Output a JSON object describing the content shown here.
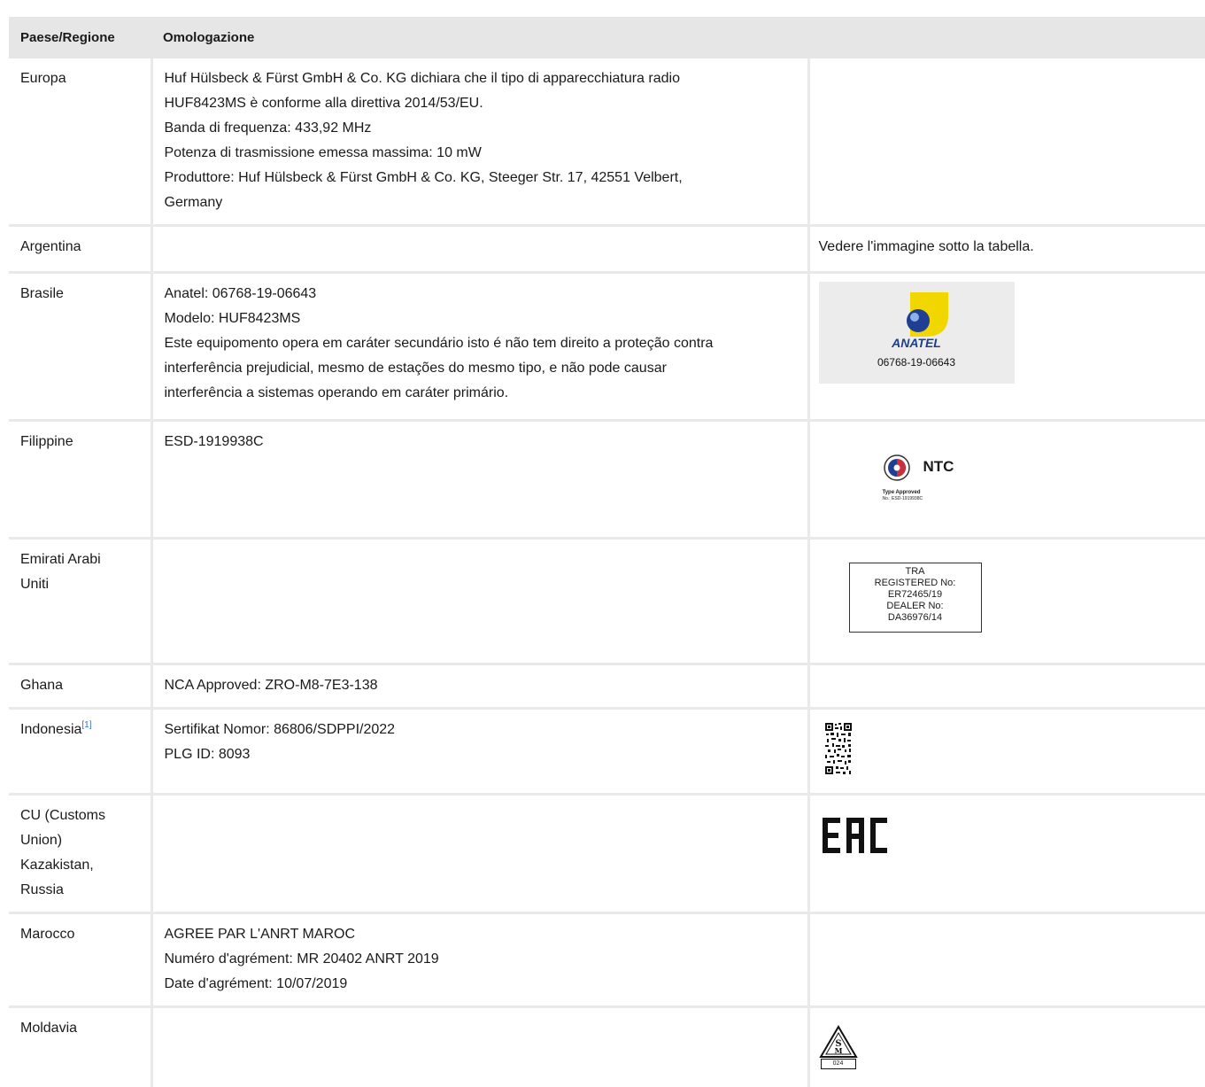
{
  "header": {
    "col1": "Paese/Regione",
    "col2": "Omologazione"
  },
  "rows": [
    {
      "region": "Europa",
      "lines": [
        "Huf Hülsbeck & Fürst GmbH & Co. KG dichiara che il tipo di apparecchiatura radio",
        "HUF8423MS è conforme alla direttiva 2014/53/EU.",
        "Banda di frequenza: 433,92 MHz",
        "Potenza di trasmissione emessa massima: 10 mW",
        "Produttore: Huf Hülsbeck & Fürst GmbH & Co. KG, Steeger Str. 17, 42551 Velbert,",
        "Germany"
      ]
    },
    {
      "region": "Argentina",
      "note": "Vedere l'immagine sotto la tabella."
    },
    {
      "region": "Brasile",
      "lines": [
        "Anatel: 06768-19-06643",
        "Modelo: HUF8423MS",
        "Este equipomento opera em caráter secundário isto é não tem direito a proteção contra",
        "interferência prejudicial, mesmo de estações do mesmo tipo, e não pode causar",
        "interferência a sistemas operando em caráter primário."
      ],
      "logo": {
        "brand": "ANATEL",
        "number": "06768-19-06643"
      }
    },
    {
      "region": "Filippine",
      "lines": [
        "ESD-1919938C"
      ],
      "logo": {
        "brand": "NTC",
        "approved": "Type Approved",
        "number": "No.: ESD-1919938C"
      }
    },
    {
      "region_lines": [
        "Emirati Arabi",
        "Uniti"
      ],
      "logo": {
        "lines": [
          "TRA",
          "REGISTERED No:",
          "ER72465/19",
          "DEALER No:",
          "DA36976/14"
        ]
      }
    },
    {
      "region": "Ghana",
      "lines": [
        "NCA Approved: ZRO-M8-7E3-138"
      ]
    },
    {
      "region": "Indonesia",
      "footnote": "[1]",
      "lines": [
        "Sertifikat Nomor: 86806/SDPPI/2022",
        "PLG ID: 8093"
      ]
    },
    {
      "region_lines": [
        "CU (Customs",
        "Union)",
        "Kazakistan,",
        "Russia"
      ],
      "logo": {
        "mark": "EAC"
      }
    },
    {
      "region": "Marocco",
      "lines": [
        "AGREE PAR L'ANRT MAROC",
        "Numéro d'agrément: MR 20402 ANRT 2019",
        "Date d'agrément: 10/07/2019"
      ]
    },
    {
      "region": "Moldavia",
      "logo": {
        "number": "024"
      }
    }
  ],
  "icons": {
    "anatel": "anatel-logo",
    "ntc": "ntc-logo",
    "eac": "eac-mark",
    "qr": "qr-code",
    "moldova": "moldova-sm-mark"
  }
}
